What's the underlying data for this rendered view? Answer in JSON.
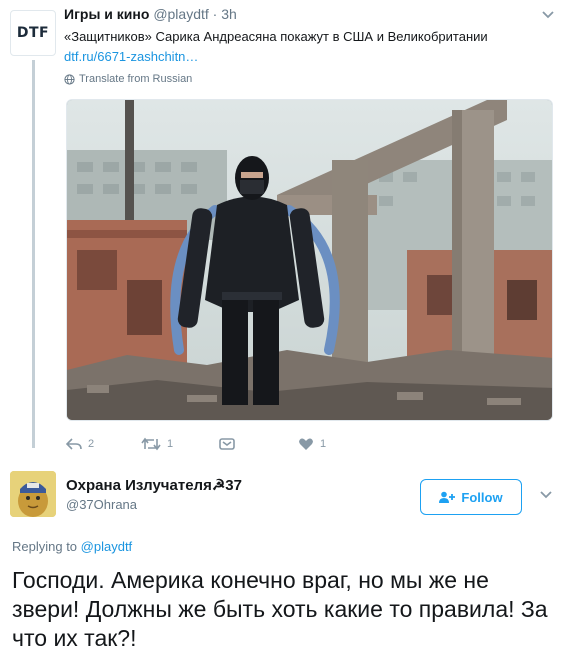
{
  "tweet1": {
    "avatar_text": "DTF",
    "name": "Игры и кино",
    "handle": "@playdtf",
    "separator": "·",
    "time": "3h",
    "text": "«Защитников» Сарика Андреасяна покажут в США и Великобритании",
    "link": "dtf.ru/6671-zashchitn…",
    "translate": "Translate from Russian",
    "actions": {
      "reply_count": "2",
      "retweet_count": "1",
      "like_count": "1"
    }
  },
  "tweet2": {
    "name": "Охрана Излучателя☭37",
    "handle": "@37Ohrana",
    "follow_label": "Follow",
    "replying_prefix": "Replying to",
    "replying_handle": "@playdtf",
    "text": "Господи. Америка конечно враг, но мы же не звери! Должны же быть хоть какие то правила! За что их так?!"
  },
  "colors": {
    "accent": "#1da1f2",
    "link": "#1b95e0",
    "muted": "#657786",
    "thread_line": "#c4cfd6"
  },
  "icons": [
    "chevron-down-icon",
    "globe-icon",
    "reply-icon",
    "retweet-icon",
    "dm-icon",
    "heart-icon",
    "follow-user-icon"
  ]
}
